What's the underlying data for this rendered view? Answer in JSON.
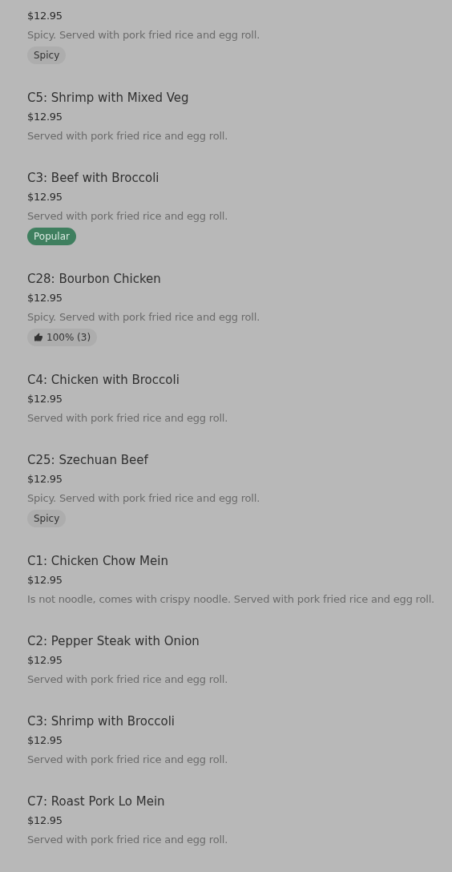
{
  "items": [
    {
      "price": "$12.95",
      "description": "Spicy. Served with pork fried rice and egg roll.",
      "badge": {
        "kind": "tag",
        "text": "Spicy"
      }
    },
    {
      "title": "C5: Shrimp with Mixed Veg",
      "price": "$12.95",
      "description": "Served with pork fried rice and egg roll."
    },
    {
      "title": "C3: Beef with Broccoli",
      "price": "$12.95",
      "description": "Served with pork fried rice and egg roll.",
      "badge": {
        "kind": "popular",
        "text": "Popular"
      }
    },
    {
      "title": "C28: Bourbon Chicken",
      "price": "$12.95",
      "description": "Spicy. Served with pork fried rice and egg roll.",
      "badge": {
        "kind": "rating",
        "text": "100% (3)"
      }
    },
    {
      "title": "C4: Chicken with Broccoli",
      "price": "$12.95",
      "description": "Served with pork fried rice and egg roll."
    },
    {
      "title": "C25: Szechuan Beef",
      "price": "$12.95",
      "description": "Spicy. Served with pork fried rice and egg roll.",
      "badge": {
        "kind": "tag",
        "text": "Spicy"
      }
    },
    {
      "title": "C1: Chicken Chow Mein",
      "price": "$12.95",
      "description": "Is not noodle, comes with crispy noodle. Served with pork fried rice and egg roll."
    },
    {
      "title": "C2: Pepper Steak with Onion",
      "price": "$12.95",
      "description": "Served with pork fried rice and egg roll."
    },
    {
      "title": "C3: Shrimp with Broccoli",
      "price": "$12.95",
      "description": "Served with pork fried rice and egg roll."
    },
    {
      "title": "C7: Roast Pork Lo Mein",
      "price": "$12.95",
      "description": "Served with pork fried rice and egg roll."
    }
  ]
}
